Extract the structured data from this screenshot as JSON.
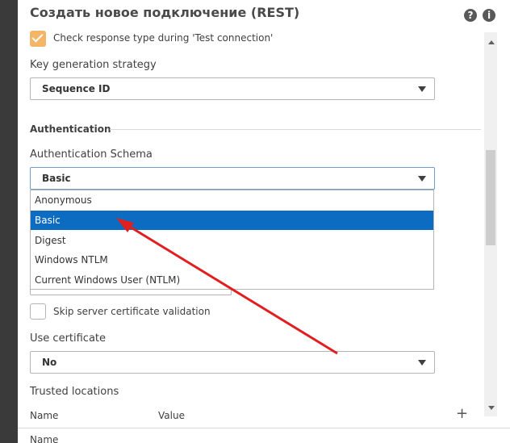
{
  "dialog": {
    "title": "Создать новое подключение (REST)",
    "help_icon": "?",
    "info_icon": "i"
  },
  "check_response": {
    "label": "Check response type during 'Test connection'",
    "checked": true
  },
  "key_generation": {
    "label": "Key generation strategy",
    "value": "Sequence ID"
  },
  "authentication": {
    "section_title": "Authentication",
    "schema_label": "Authentication Schema",
    "schema_value": "Basic",
    "options": [
      {
        "label": "Anonymous",
        "selected": false
      },
      {
        "label": "Basic",
        "selected": true
      },
      {
        "label": "Digest",
        "selected": false
      },
      {
        "label": "Windows NTLM",
        "selected": false
      },
      {
        "label": "Current Windows User (NTLM)",
        "selected": false
      }
    ]
  },
  "skip_cert": {
    "label": "Skip server certificate validation",
    "checked": false
  },
  "use_certificate": {
    "label": "Use certificate",
    "value": "No"
  },
  "trusted_locations": {
    "label": "Trusted locations",
    "col_name": "Name",
    "col_value": "Value",
    "add_icon": "+"
  },
  "footer": {
    "name_label": "Name"
  },
  "colors": {
    "accent_checkbox": "#f3b567",
    "selected_option": "#0c6cc2",
    "annotation_arrow": "#e02020"
  }
}
